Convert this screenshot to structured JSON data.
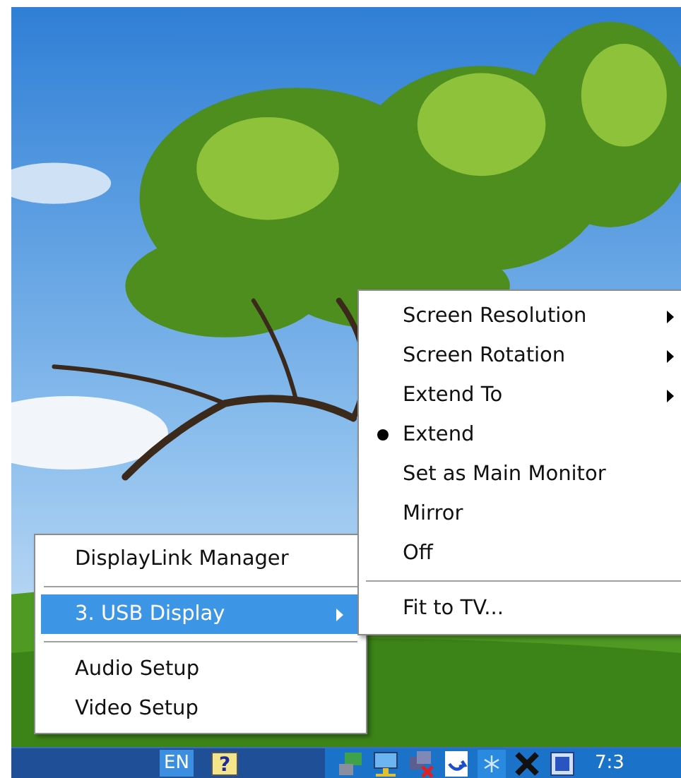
{
  "tray_menu": {
    "items": [
      {
        "kind": "item",
        "label": "DisplayLink Manager",
        "selected": false,
        "has_submenu": false
      },
      {
        "kind": "separator"
      },
      {
        "kind": "item",
        "label": "3. USB Display",
        "selected": true,
        "has_submenu": true
      },
      {
        "kind": "separator"
      },
      {
        "kind": "item",
        "label": "Audio Setup",
        "selected": false,
        "has_submenu": false
      },
      {
        "kind": "item",
        "label": "Video Setup",
        "selected": false,
        "has_submenu": false
      }
    ]
  },
  "display_submenu": {
    "items": [
      {
        "kind": "item",
        "label": "Screen Resolution",
        "checked": false,
        "has_submenu": true
      },
      {
        "kind": "item",
        "label": "Screen Rotation",
        "checked": false,
        "has_submenu": true
      },
      {
        "kind": "item",
        "label": "Extend To",
        "checked": false,
        "has_submenu": true
      },
      {
        "kind": "item",
        "label": "Extend",
        "checked": true,
        "has_submenu": false
      },
      {
        "kind": "item",
        "label": "Set as Main Monitor",
        "checked": false,
        "has_submenu": false
      },
      {
        "kind": "item",
        "label": "Mirror",
        "checked": false,
        "has_submenu": false
      },
      {
        "kind": "item",
        "label": "Off",
        "checked": false,
        "has_submenu": false
      },
      {
        "kind": "separator"
      },
      {
        "kind": "item",
        "label": "Fit to TV...",
        "checked": false,
        "has_submenu": false
      }
    ]
  },
  "taskbar": {
    "language": "EN",
    "help_label": "?",
    "clock": "7:3"
  }
}
